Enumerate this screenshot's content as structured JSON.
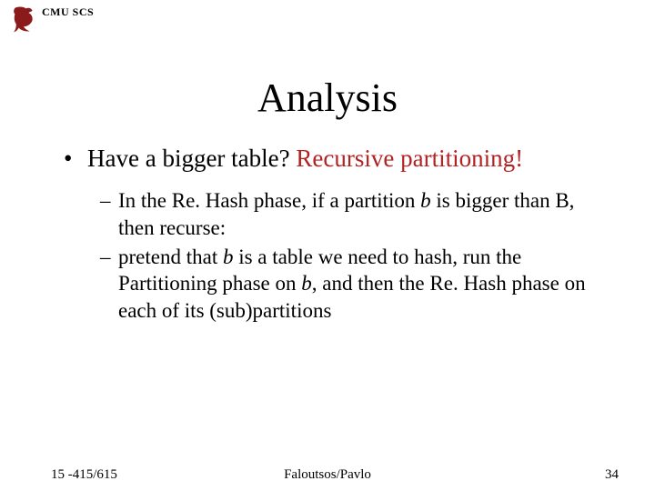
{
  "header": {
    "org": "CMU SCS",
    "logo_name": "griffin-logo"
  },
  "title": "Analysis",
  "bullet_main": {
    "lead": "Have a bigger table?  ",
    "red": "Recursive partitioning!"
  },
  "sub1": {
    "p1": "In the Re. Hash phase, if a partition ",
    "i1": "b",
    "p2": " is bigger than B, then recurse:"
  },
  "sub2": {
    "p1": "pretend that ",
    "i1": "b",
    "p2": " is a table we need to hash, run the Partitioning phase on ",
    "i2": "b",
    "p3": ", and then the Re. Hash phase on each of its (sub)partitions"
  },
  "footer": {
    "left": "15 -415/615",
    "center": "Faloutsos/Pavlo",
    "right": "34"
  }
}
